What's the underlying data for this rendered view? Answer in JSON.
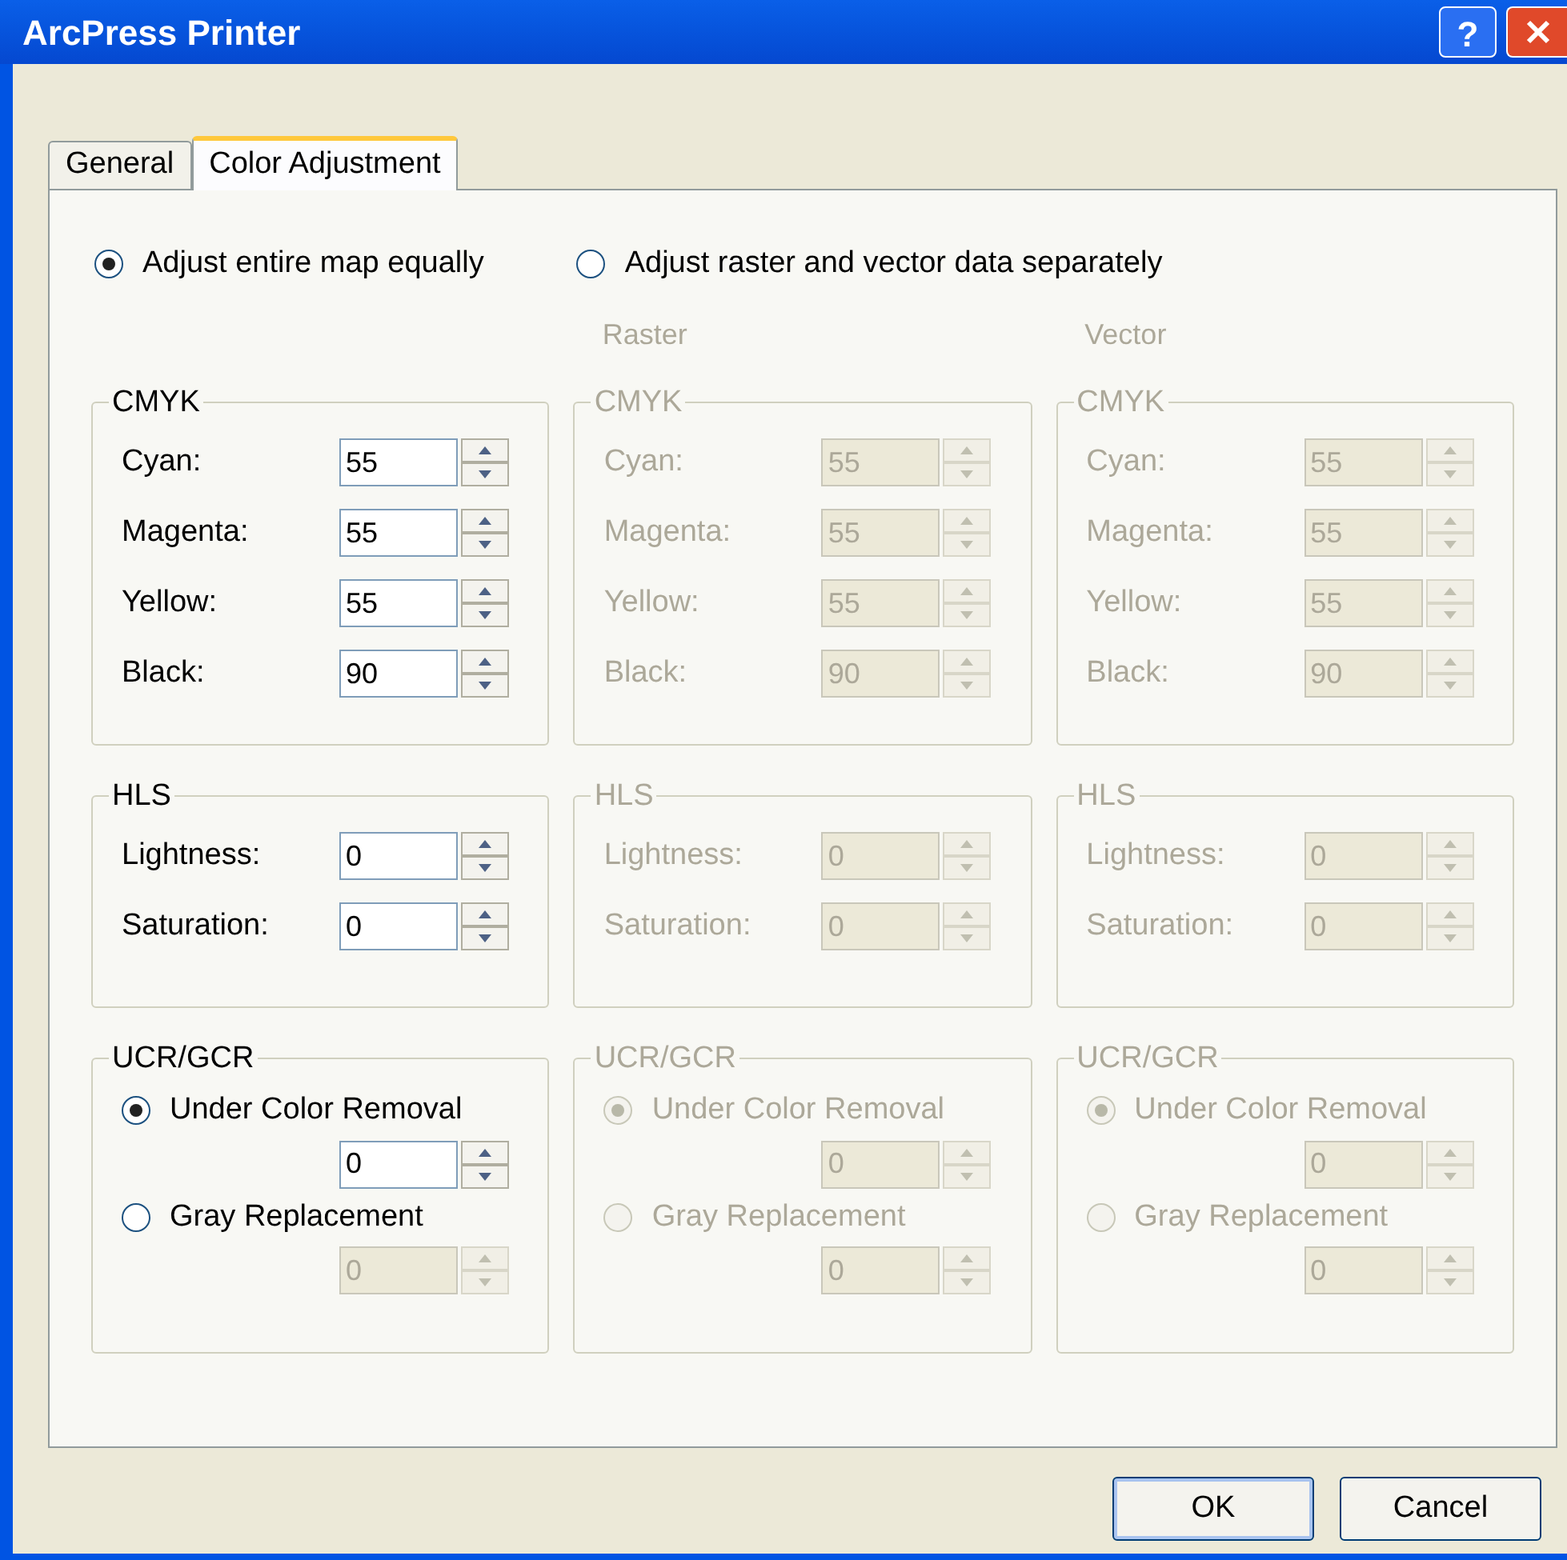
{
  "window": {
    "title": "ArcPress Printer",
    "help_label": "?"
  },
  "tabs": [
    {
      "label": "General",
      "selected": false
    },
    {
      "label": "Color Adjustment",
      "selected": true
    }
  ],
  "mode_options": [
    {
      "label": "Adjust entire map equally",
      "selected": true
    },
    {
      "label": "Adjust raster and vector data separately",
      "selected": false
    }
  ],
  "columns": [
    {
      "disabled": false,
      "cmyk": {
        "title": "CMYK",
        "fields": [
          {
            "label": "Cyan:",
            "value": "55"
          },
          {
            "label": "Magenta:",
            "value": "55"
          },
          {
            "label": "Yellow:",
            "value": "55"
          },
          {
            "label": "Black:",
            "value": "90"
          }
        ]
      },
      "hls": {
        "title": "HLS",
        "fields": [
          {
            "label": "Lightness:",
            "value": "0"
          },
          {
            "label": "Saturation:",
            "value": "0"
          }
        ]
      },
      "ucr": {
        "title": "UCR/GCR",
        "options": [
          {
            "label": "Under Color Removal",
            "selected": true,
            "value": "0",
            "field_disabled": false
          },
          {
            "label": "Gray Replacement",
            "selected": false,
            "value": "0",
            "field_disabled": true
          }
        ]
      }
    },
    {
      "header": "Raster",
      "disabled": true,
      "cmyk": {
        "title": "CMYK",
        "fields": [
          {
            "label": "Cyan:",
            "value": "55"
          },
          {
            "label": "Magenta:",
            "value": "55"
          },
          {
            "label": "Yellow:",
            "value": "55"
          },
          {
            "label": "Black:",
            "value": "90"
          }
        ]
      },
      "hls": {
        "title": "HLS",
        "fields": [
          {
            "label": "Lightness:",
            "value": "0"
          },
          {
            "label": "Saturation:",
            "value": "0"
          }
        ]
      },
      "ucr": {
        "title": "UCR/GCR",
        "options": [
          {
            "label": "Under Color Removal",
            "selected": true,
            "value": "0"
          },
          {
            "label": "Gray Replacement",
            "selected": false,
            "value": "0"
          }
        ]
      }
    },
    {
      "header": "Vector",
      "disabled": true,
      "cmyk": {
        "title": "CMYK",
        "fields": [
          {
            "label": "Cyan:",
            "value": "55"
          },
          {
            "label": "Magenta:",
            "value": "55"
          },
          {
            "label": "Yellow:",
            "value": "55"
          },
          {
            "label": "Black:",
            "value": "90"
          }
        ]
      },
      "hls": {
        "title": "HLS",
        "fields": [
          {
            "label": "Lightness:",
            "value": "0"
          },
          {
            "label": "Saturation:",
            "value": "0"
          }
        ]
      },
      "ucr": {
        "title": "UCR/GCR",
        "options": [
          {
            "label": "Under Color Removal",
            "selected": true,
            "value": "0"
          },
          {
            "label": "Gray Replacement",
            "selected": false,
            "value": "0"
          }
        ]
      }
    }
  ],
  "buttons": [
    {
      "label": "OK",
      "default": true
    },
    {
      "label": "Cancel",
      "default": false
    }
  ]
}
